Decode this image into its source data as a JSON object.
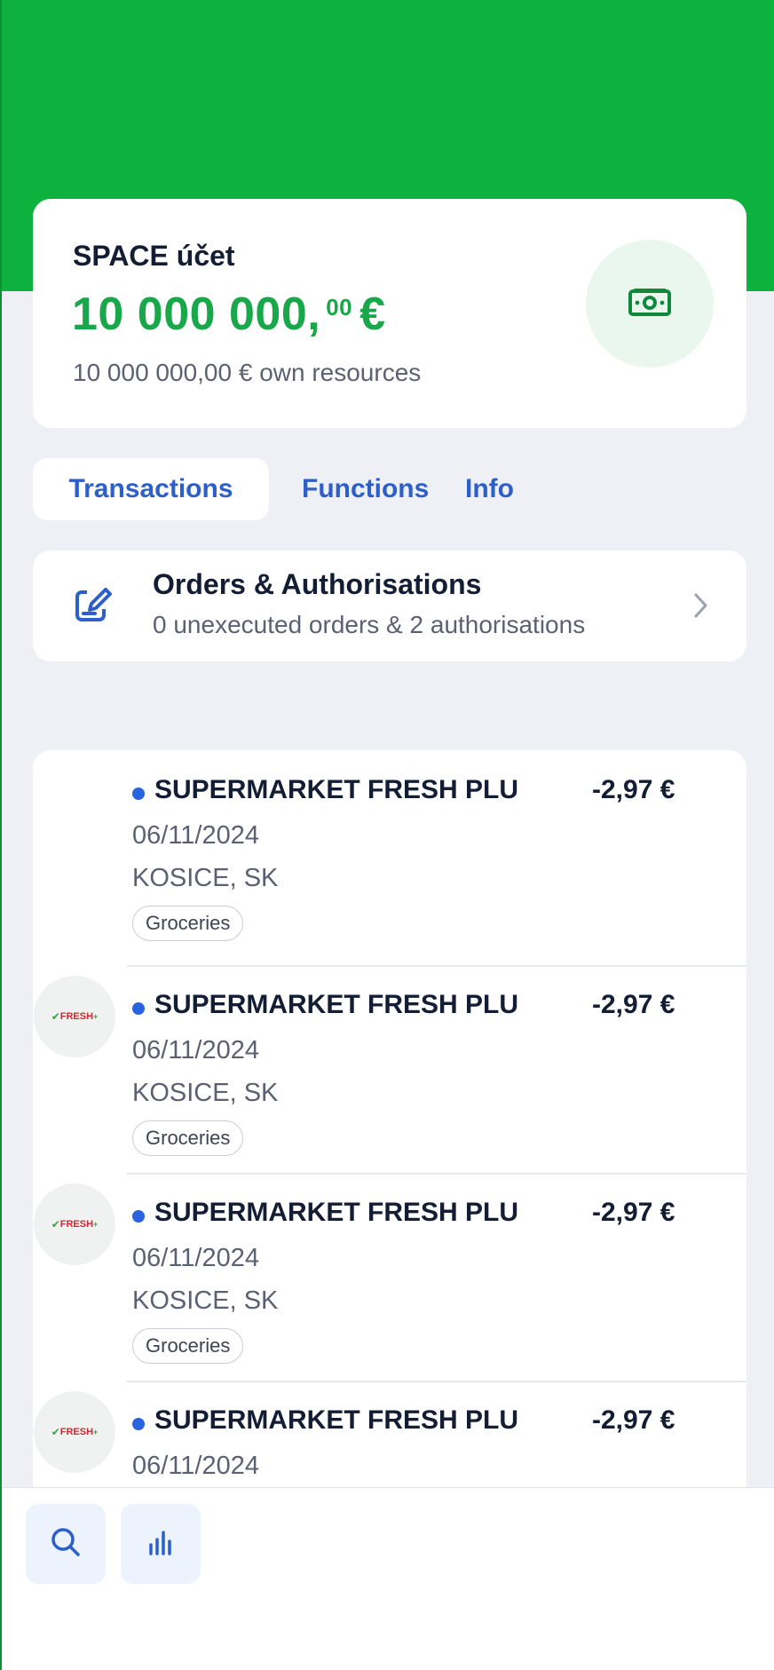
{
  "account": {
    "name": "SPACE účet",
    "balance_main": "10 000 000,",
    "balance_cents": "00",
    "balance_currency": "€",
    "own_resources": "10 000 000,00 € own resources",
    "icon": "banknote-icon"
  },
  "tabs": [
    {
      "label": "Transactions",
      "active": true
    },
    {
      "label": "Functions",
      "active": false
    },
    {
      "label": "Info",
      "active": false
    }
  ],
  "orders": {
    "title": "Orders & Authorisations",
    "subtitle": "0 unexecuted orders & 2 authorisations",
    "icon": "edit-icon"
  },
  "transactions": [
    {
      "merchant": "SUPERMARKET FRESH PLU",
      "amount": "-2,97 €",
      "date": "06/11/2024",
      "location": "KOSICE, SK",
      "category": "Groceries",
      "logo": null
    },
    {
      "merchant": "SUPERMARKET FRESH PLU",
      "amount": "-2,97 €",
      "date": "06/11/2024",
      "location": "KOSICE, SK",
      "category": "Groceries",
      "logo": "FRESH"
    },
    {
      "merchant": "SUPERMARKET FRESH PLU",
      "amount": "-2,97 €",
      "date": "06/11/2024",
      "location": "KOSICE, SK",
      "category": "Groceries",
      "logo": "FRESH"
    },
    {
      "merchant": "SUPERMARKET FRESH PLU",
      "amount": "-2,97 €",
      "date": "06/11/2024",
      "location": "",
      "category": "",
      "logo": "FRESH"
    }
  ],
  "bottom_bar": {
    "search_icon": "search-icon",
    "stats_icon": "bar-chart-icon"
  },
  "colors": {
    "brand_green": "#0db23e",
    "balance_green": "#18a84a",
    "link_blue": "#2c5fc9",
    "unread_dot": "#2a63e0"
  }
}
